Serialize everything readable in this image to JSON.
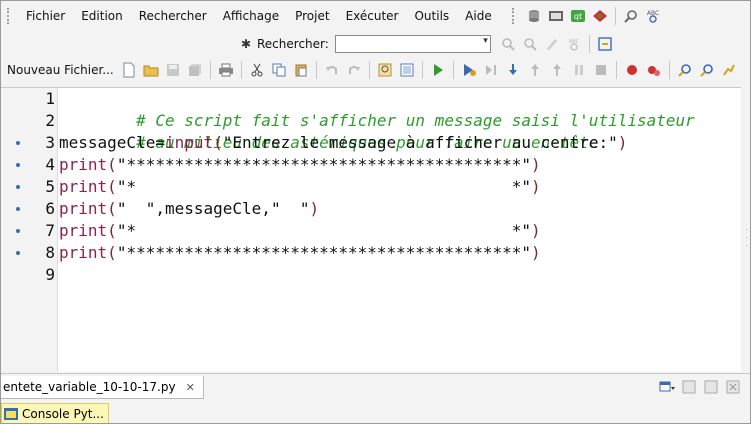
{
  "menubar": {
    "items": [
      "Fichier",
      "Edition",
      "Rechercher",
      "Affichage",
      "Projet",
      "Exécuter",
      "Outils",
      "Aide"
    ],
    "icons": [
      "database-icon",
      "image-icon",
      "qt-icon",
      "bug-icon",
      "find-icon",
      "spell-check-icon"
    ]
  },
  "search": {
    "label": "Rechercher:",
    "value": "",
    "placeholder": ""
  },
  "toolbar": {
    "new_file_label": "Nouveau Fichier...",
    "icons": [
      "new-file-icon",
      "open-folder-icon",
      "save-icon",
      "save-all-icon",
      "print-icon",
      "cut-icon",
      "copy-icon",
      "paste-icon",
      "undo-icon",
      "redo-icon",
      "find-icon",
      "preview-icon",
      "run-icon",
      "debug-icon",
      "step-icon",
      "step-into-icon",
      "step-out-icon",
      "continue-icon",
      "pause-icon",
      "stop-icon",
      "breakpoint-icon",
      "clear-breakpoints-icon",
      "zoom-in-icon",
      "zoom-out-icon",
      "more-icon"
    ],
    "accent": "#2d9c2d"
  },
  "editor": {
    "line_numbers": [
      "1",
      "2",
      "3",
      "4",
      "5",
      "6",
      "7",
      "8",
      "9"
    ],
    "lines": {
      "l1": "# Ce script fait s'afficher un message saisi l'utilisateur",
      "l2": "# au milieu des astériques pour faire un en-tête",
      "l3_a": "messageCle=",
      "l3_b": "input",
      "l3_c": "(",
      "l3_d": "\"Entrez le message à afficher au centre:\"",
      "l3_e": ")",
      "l4_a": "print",
      "l4_b": "(",
      "l4_c": "\"*****************************************\"",
      "l4_d": ")",
      "l5_a": "print",
      "l5_b": "(",
      "l5_c": "\"*                                       *\"",
      "l5_d": ")",
      "l6_a": "print",
      "l6_b": "(",
      "l6_c": "\"  \",messageCle,\"  \"",
      "l6_d": ")",
      "l7_a": "print",
      "l7_b": "(",
      "l7_c": "\"*                                       *\"",
      "l7_d": ")",
      "l8_a": "print",
      "l8_b": "(",
      "l8_c": "\"*****************************************\"",
      "l8_d": ")"
    },
    "colors": {
      "comment": "#2d9c2d",
      "function": "#8b2252",
      "marker": "#3b6cb7"
    }
  },
  "tabs": {
    "file_tab": "entete_variable_10-10-17.py",
    "close": "✕"
  },
  "console": {
    "label": "Console Pyt..."
  }
}
